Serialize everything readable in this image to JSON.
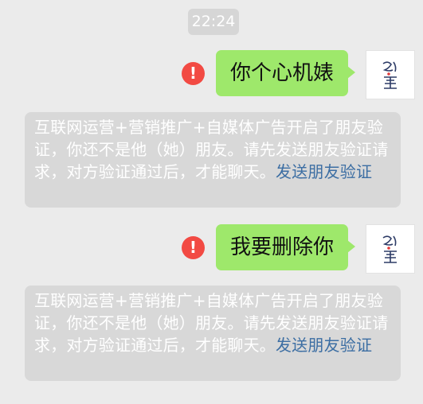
{
  "chat": {
    "time": "22:24",
    "messages": [
      {
        "text": "你个心机婊",
        "error_icon": "!",
        "avatar_icon": "avatar-icon"
      },
      {
        "text": "我要删除你",
        "error_icon": "!",
        "avatar_icon": "avatar-icon"
      }
    ],
    "system_notices": [
      {
        "text": "互联网运营+营销推广+自媒体广告开启了朋友验证，你还不是他（她）朋友。请先发送朋友验证请求，对方验证通过后，才能聊天。",
        "link": "发送朋友验证"
      },
      {
        "text": "互联网运营+营销推广+自媒体广告开启了朋友验证，你还不是他（她）朋友。请先发送朋友验证请求，对方验证通过后，才能聊天。",
        "link": "发送朋友验证"
      }
    ]
  },
  "colors": {
    "background": "#ebebeb",
    "bubble_green": "#9ee86b",
    "error_red": "#f24a43",
    "system_bg": "#d8d8d8",
    "link_blue": "#3c6ea3"
  }
}
